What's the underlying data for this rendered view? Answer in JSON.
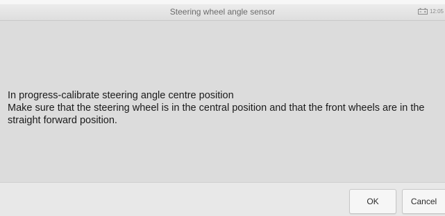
{
  "header": {
    "title": "Steering wheel angle sensor",
    "time": "12:05",
    "battery_icon": "car-battery-icon"
  },
  "main": {
    "line1": "In progress-calibrate steering angle centre position",
    "line2": "Make sure that the steering wheel is in the central position and that the front wheels are in the straight forward position."
  },
  "buttons": {
    "ok_label": "OK",
    "cancel_label": "Cancel"
  }
}
